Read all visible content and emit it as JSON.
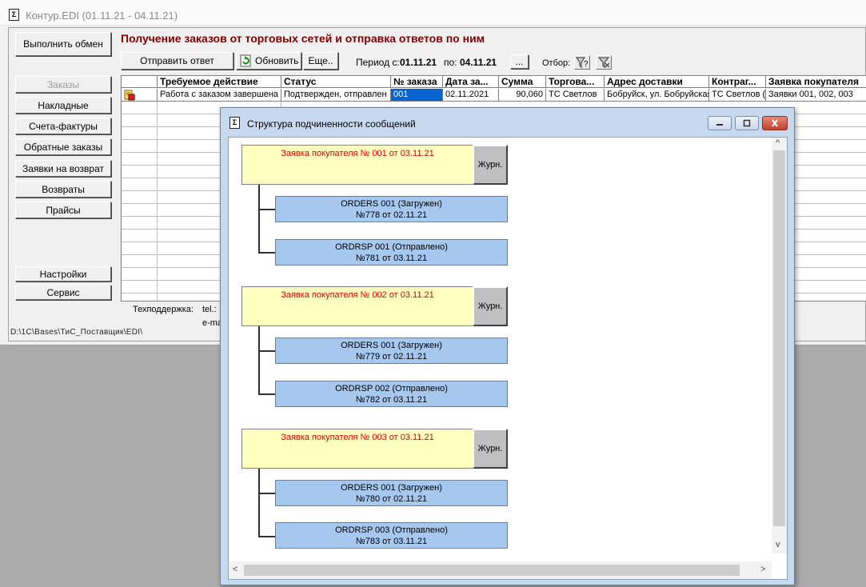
{
  "main_window": {
    "title": "Контур.EDI (01.11.21 - 04.11.21)",
    "app_icon_glyph": "Σ",
    "page_title": "Получение заказов от торговых сетей и отправка ответов по ним",
    "exchange_button": "Выполнить обмен",
    "nav": [
      "Заказы",
      "Накладные",
      "Счета-фактуры",
      "Обратные заказы",
      "Заявки на возврат",
      "Возвраты",
      "Прайсы"
    ],
    "settings_button": "Настройки",
    "service_button": "Сервис",
    "toolbar": {
      "send_reply": "Отправить ответ",
      "refresh": "Обновить",
      "more": "Еще..",
      "period_label": "Период с:",
      "period_from": "01.11.21",
      "period_to_label": "по:",
      "period_to": "04.11.21",
      "period_picker": "...",
      "filter_label": "Отбор:"
    },
    "table": {
      "headers": [
        "",
        "Требуемое действие",
        "Статус",
        "№ заказа",
        "Дата за...",
        "Сумма",
        "Торгова...",
        "Адрес доставки",
        "Контраг...",
        "Заявка покупателя"
      ],
      "row": [
        "Работа с заказом завершена",
        "Подтвержден, отправлен",
        "001",
        "02.11.2021",
        "90,060",
        "ТС Светлов",
        "Бобруйск, ул. Бобруйская",
        "ТС Светлов (",
        "Заявки 001, 002, 003"
      ]
    },
    "footer": {
      "support_label": "Техподдержка:",
      "tel": "tel.:",
      "email": "e-ma",
      "path": "D:\\1C\\Bases\\ТиС_Поставщик\\EDI\\"
    }
  },
  "dialog": {
    "title": "Структура подчиненности сообщений",
    "journal_label": "Журн.",
    "groups": [
      {
        "request": "Заявка покупателя № 001 от 03.11.21",
        "messages": [
          {
            "line1": "ORDERS 001 (Загружен)",
            "line2": "№778 от 02.11.21"
          },
          {
            "line1": "ORDRSP 001 (Отправлено)",
            "line2": "№781 от 03.11.21"
          }
        ]
      },
      {
        "request": "Заявка покупателя № 002 от 03.11.21",
        "messages": [
          {
            "line1": "ORDERS 001 (Загружен)",
            "line2": "№779 от 02.11.21"
          },
          {
            "line1": "ORDRSP 002 (Отправлено)",
            "line2": "№782 от 03.11.21"
          }
        ]
      },
      {
        "request": "Заявка покупателя № 003 от 03.11.21",
        "messages": [
          {
            "line1": "ORDERS 001 (Загружен)",
            "line2": "№780 от 02.11.21"
          },
          {
            "line1": "ORDRSP 003 (Отправлено)",
            "line2": "№783 от 03.11.21"
          }
        ]
      }
    ]
  },
  "colors": {
    "title_red": "#800000",
    "request_text": "#e00000",
    "request_bg": "#ffffc0",
    "message_bg": "#a6c8ef",
    "selection": "#0a64d0"
  },
  "icons": [
    "app-icon",
    "refresh-icon",
    "document-status-icon",
    "filter-icon",
    "filter-clear-icon",
    "minimize-icon",
    "maximize-icon",
    "close-icon"
  ]
}
